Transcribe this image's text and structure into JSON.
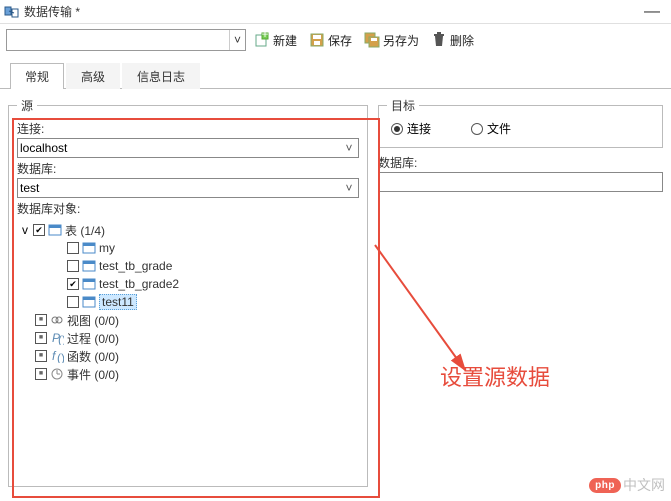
{
  "window": {
    "title": "数据传输 *",
    "minimize": "—"
  },
  "toolbar": {
    "new_label": "新建",
    "save_label": "保存",
    "saveas_label": "另存为",
    "delete_label": "删除"
  },
  "tabs": {
    "general": "常规",
    "advanced": "高级",
    "log": "信息日志"
  },
  "source": {
    "legend": "源",
    "connection_label": "连接:",
    "connection_value": "localhost",
    "database_label": "数据库:",
    "database_value": "test",
    "objects_label": "数据库对象:",
    "tree": {
      "tables": {
        "label": "表",
        "count": "(1/4)"
      },
      "t1": "my",
      "t2": "test_tb_grade",
      "t3": "test_tb_grade2",
      "t4": "test11",
      "views": {
        "label": "视图",
        "count": "(0/0)"
      },
      "procs": {
        "label": "过程",
        "count": "(0/0)"
      },
      "funcs": {
        "label": "函数",
        "count": "(0/0)"
      },
      "events": {
        "label": "事件",
        "count": "(0/0)"
      }
    }
  },
  "target": {
    "legend": "目标",
    "radio_connection": "连接",
    "radio_file": "文件",
    "database_label": "数据库:"
  },
  "annotation": "设置源数据",
  "watermark": {
    "badge": "php",
    "text": "中文网"
  }
}
